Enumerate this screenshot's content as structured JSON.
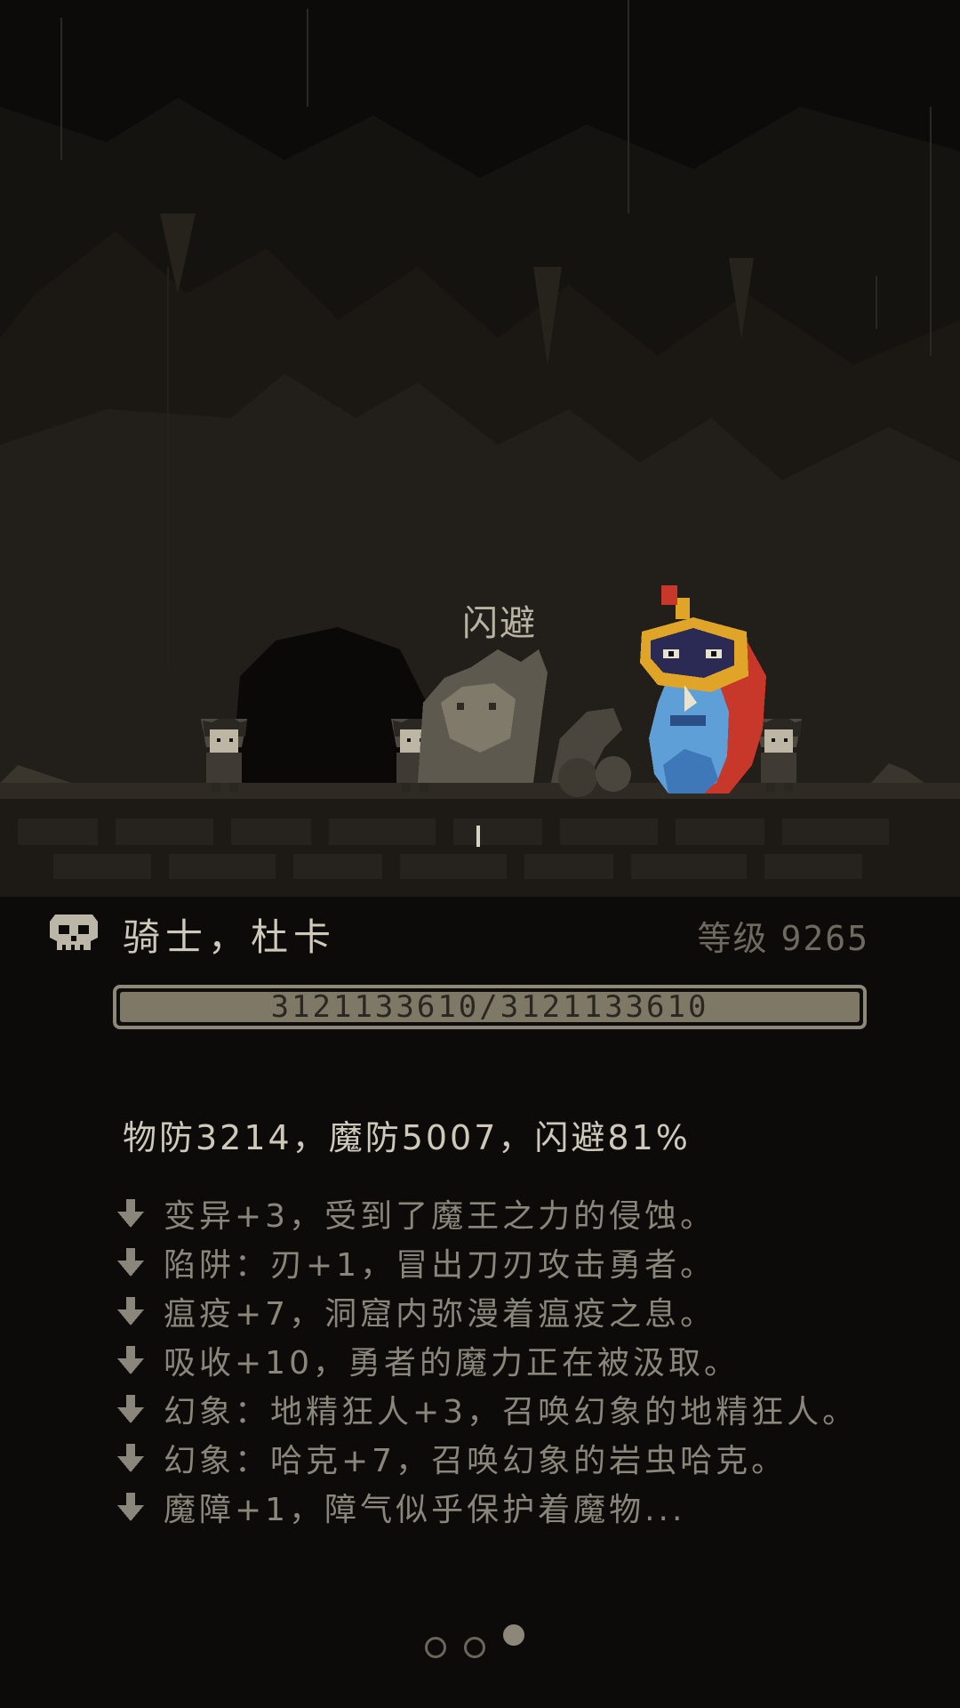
{
  "battle": {
    "floating_text": "闪避"
  },
  "enemy": {
    "name": "骑士，杜卡",
    "level_label": "等级",
    "level_value": "9265",
    "hp_text": "3121133610/3121133610",
    "hp_fraction": 1.0,
    "stats_line": "物防3214，魔防5007，闪避81%"
  },
  "modifiers": [
    {
      "icon": "arrow-down-icon",
      "text": "变异+3，受到了魔王之力的侵蚀。"
    },
    {
      "icon": "arrow-down-icon",
      "text": "陷阱：刃+1，冒出刀刃攻击勇者。"
    },
    {
      "icon": "arrow-down-icon",
      "text": "瘟疫+7，洞窟内弥漫着瘟疫之息。"
    },
    {
      "icon": "arrow-down-icon",
      "text": "吸收+10，勇者的魔力正在被汲取。"
    },
    {
      "icon": "arrow-down-icon",
      "text": "幻象：地精狂人+3，召唤幻象的地精狂人。"
    },
    {
      "icon": "arrow-down-icon",
      "text": "幻象：哈克+7，召唤幻象的岩虫哈克。"
    },
    {
      "icon": "arrow-down-icon",
      "text": "魔障+1，障气似乎保护着魔物..."
    }
  ],
  "pagination": {
    "total": 3,
    "current": 3
  },
  "colors": {
    "background": "#0c0b09",
    "text_primary": "#cfc9bb",
    "text_muted": "#8b867b",
    "hp_fill": "#7e7867",
    "boss_blue": "#5d9fd6",
    "boss_red": "#c8382a",
    "boss_gold": "#e0a528"
  }
}
